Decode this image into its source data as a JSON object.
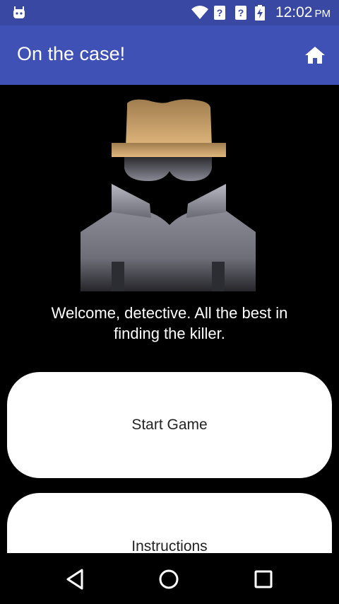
{
  "status_bar": {
    "time": "12:02",
    "ampm": "PM"
  },
  "app_bar": {
    "title": "On the case!",
    "home_icon": "home-icon"
  },
  "main": {
    "welcome_text": "Welcome, detective. All the best in finding the killer.",
    "buttons": {
      "start": "Start Game",
      "instructions": "Instructions"
    }
  },
  "nav_bar": {
    "icons": [
      "back-icon",
      "home-circle-icon",
      "recents-icon"
    ]
  },
  "colors": {
    "status_bar": "#3949a3",
    "app_bar": "#3f51b5",
    "background": "#000000",
    "button": "#ffffff"
  }
}
